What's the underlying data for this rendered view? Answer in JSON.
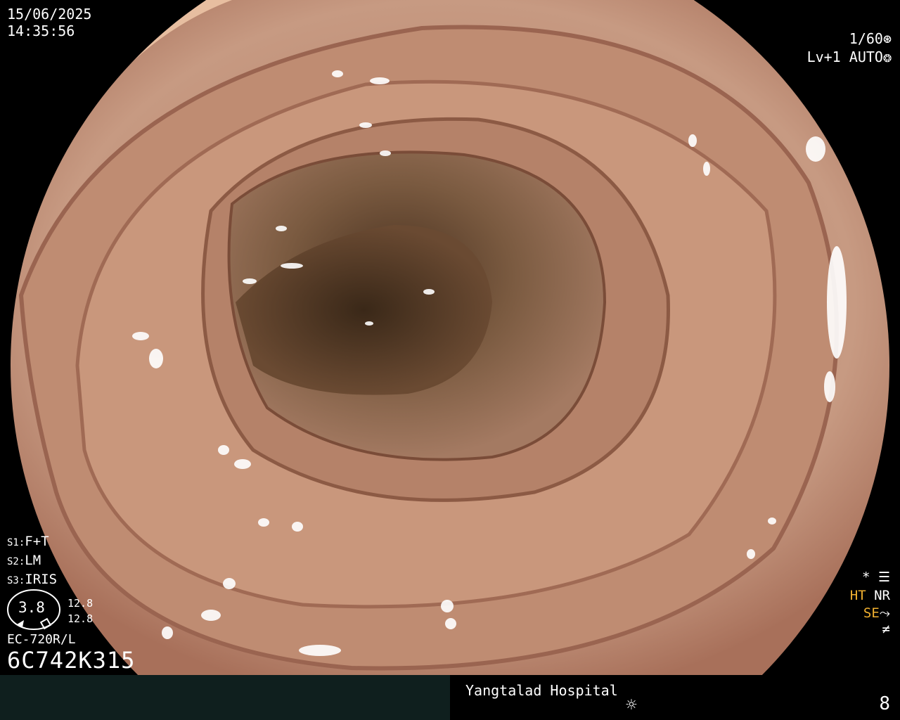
{
  "status": {
    "date": "15/06/2025",
    "time": "14:35:56",
    "shutter": "1/60",
    "level": "Lv+1",
    "iris_mode": "AUTO"
  },
  "settings": [
    {
      "key": "S1:",
      "value": "F+T"
    },
    {
      "key": "S2:",
      "value": "LM"
    },
    {
      "key": "S3:",
      "value": "IRIS"
    }
  ],
  "gauge": {
    "value": "3.8",
    "upper": "12.8",
    "lower": "12.8"
  },
  "scope": {
    "model": "EC-720R/L",
    "serial": "6C742K315"
  },
  "indicators": {
    "star": "*",
    "ht": "HT",
    "nr": "NR",
    "se": "SE",
    "colors": {
      "active": "#f0b030",
      "normal": "#ffffff"
    }
  },
  "footer": {
    "hospital": "Yangtalad Hospital",
    "page": "8",
    "footer_left_color": "#0f1f1e"
  },
  "icons": [
    "shutter-icon",
    "iris-icon",
    "settings-icon",
    "structure-enhance-icon",
    "no-flicker-icon",
    "light-icon"
  ]
}
